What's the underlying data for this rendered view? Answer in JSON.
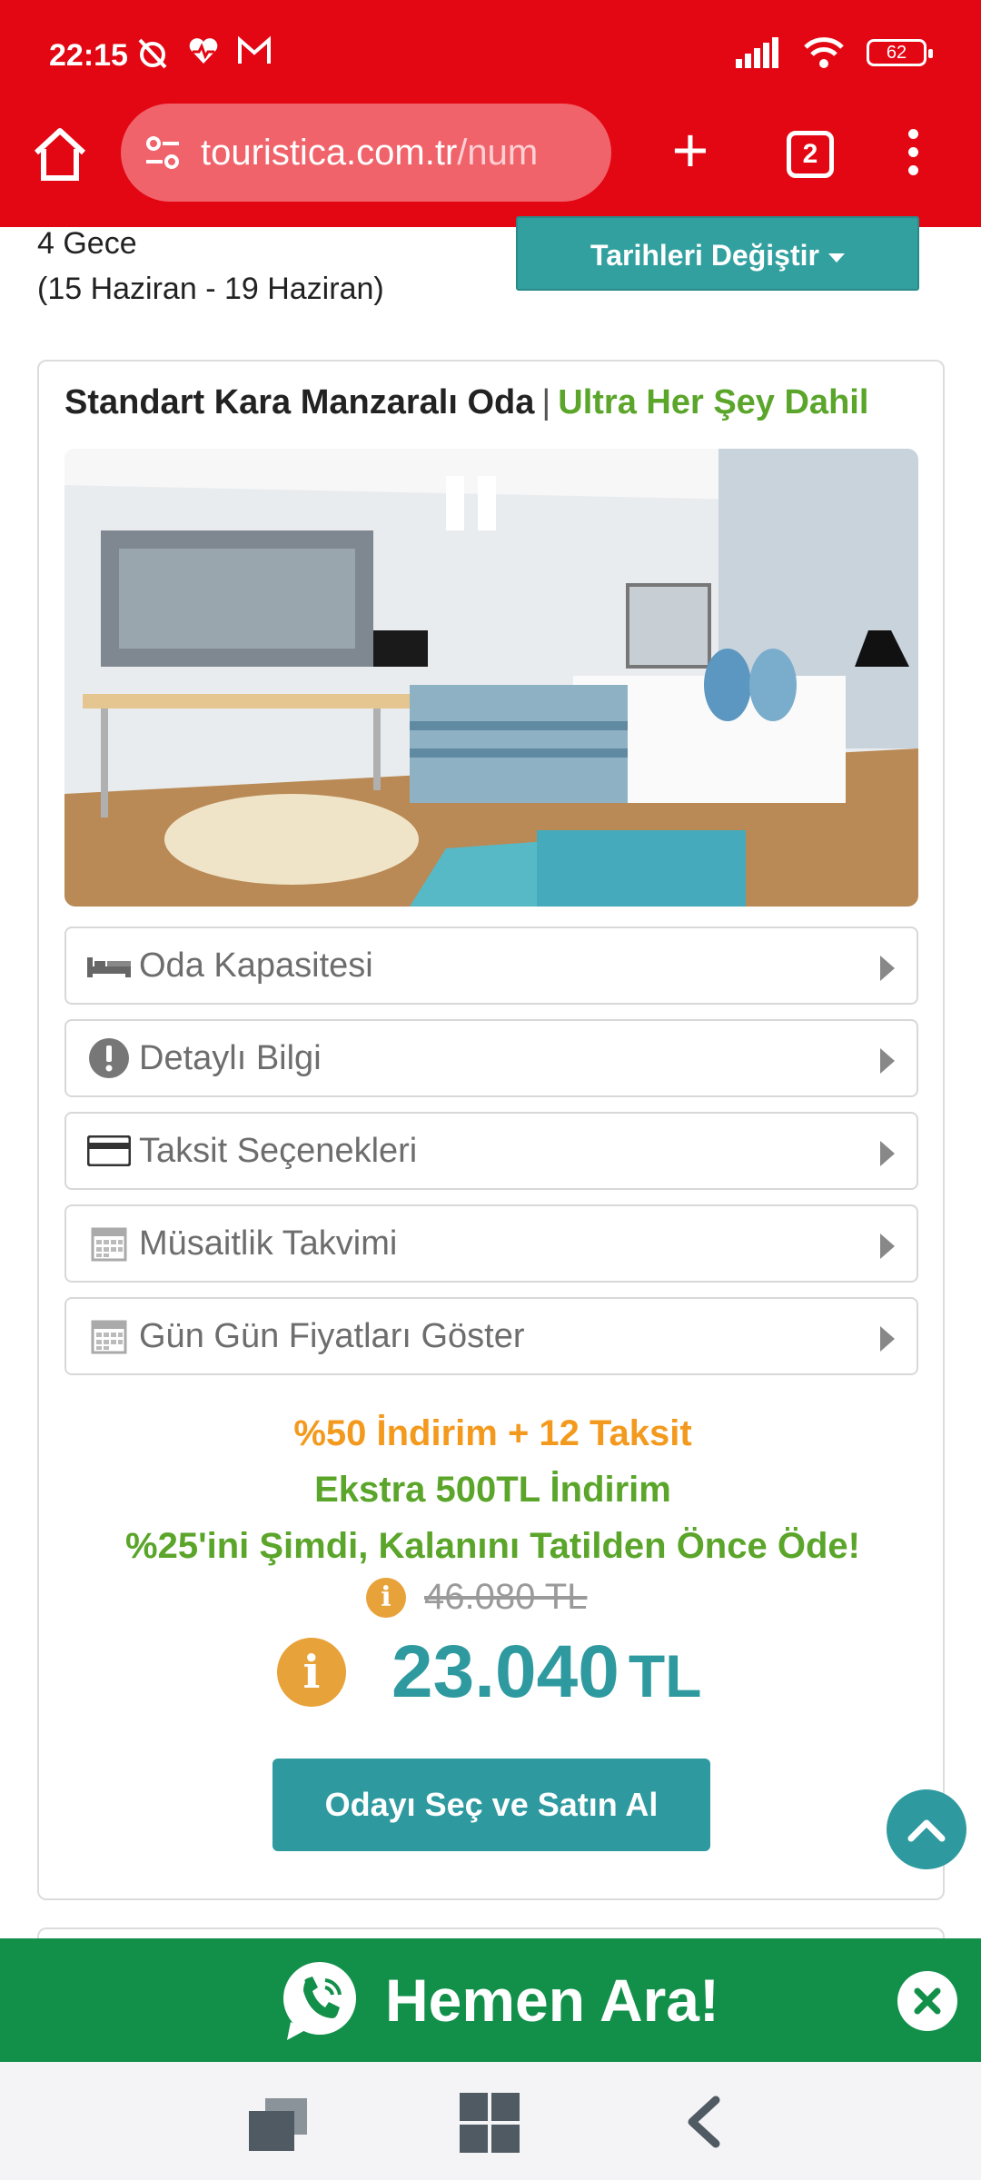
{
  "status_bar": {
    "time": "22:15",
    "battery": "62"
  },
  "browser": {
    "url_main": "touristica.com.tr",
    "url_rest": "/num",
    "tab_count": "2"
  },
  "stay": {
    "nights": "4 Gece",
    "range": "(15 Haziran - 19 Haziran)",
    "change_dates_label": "Tarihleri Değiştir"
  },
  "room": {
    "name": "Standart Kara Manzaralı Oda",
    "separator": "|",
    "board": "Ultra Her Şey Dahil",
    "accordion": [
      {
        "label": "Oda Kapasitesi",
        "icon": "bed-icon"
      },
      {
        "label": "Detaylı Bilgi",
        "icon": "exclamation-icon"
      },
      {
        "label": "Taksit Seçenekleri",
        "icon": "credit-card-icon"
      },
      {
        "label": "Müsaitlik Takvimi",
        "icon": "calendar-icon"
      },
      {
        "label": "Gün Gün Fiyatları Göster",
        "icon": "calendar-icon"
      }
    ],
    "promos": [
      "%50 İndirim + 12 Taksit",
      "Ekstra 500TL İndirim",
      "%25'ini Şimdi, Kalanını Tatilden Önce Öde!"
    ],
    "old_price": "46.080 TL",
    "price_value": "23.040",
    "price_currency": "TL",
    "buy_label": "Odayı Seç ve Satın Al"
  },
  "call_bar": {
    "label": "Hemen Ara!"
  },
  "colors": {
    "brand_red": "#e30613",
    "teal": "#2e9aa0",
    "green": "#5aa52a",
    "orange": "#f39a1e",
    "call_green": "#12904a"
  }
}
